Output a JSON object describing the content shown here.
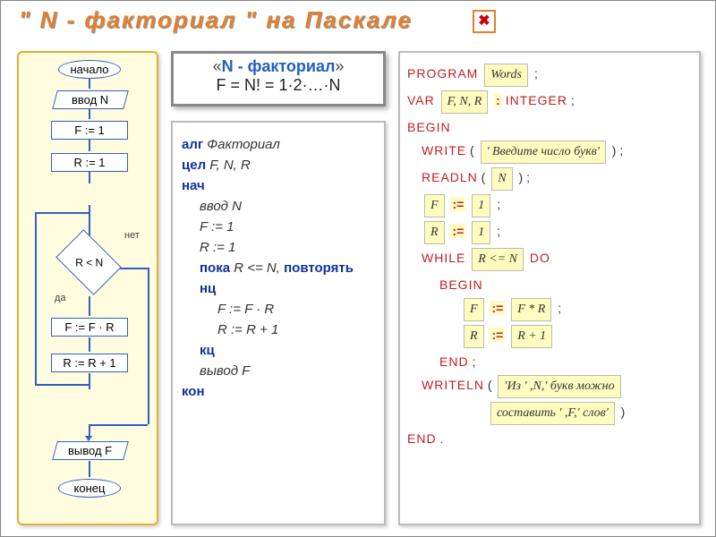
{
  "title": "\" N - факториал \"  на  Паскале",
  "close_glyph": "✖",
  "flowchart": {
    "start": "начало",
    "input": "ввод N",
    "f1": "F := 1",
    "r1": "R := 1",
    "cond": "R < N",
    "yes": "да",
    "no": "нет",
    "fupd": "F := F · R",
    "rupd": "R := R + 1",
    "output": "вывод F",
    "end": "конец"
  },
  "mid_header": {
    "line1_a": "«",
    "line1_b": "N - факториал",
    "line1_c": "»",
    "line2": "F = N! = 1·2·…·N"
  },
  "algo": {
    "alg": "алг",
    "alg_name": "Факториал",
    "decl": "цел",
    "decl_vars": "F, N, R",
    "begin": "нач",
    "input": "ввод N",
    "f1": "F := 1",
    "r1": "R := 1",
    "while_a": "пока",
    "while_cond": "R <= N,",
    "while_b": "повторять",
    "nc": "нц",
    "fupd": "F := F · R",
    "rupd": "R := R + 1",
    "kc": "кц",
    "output": "вывод F",
    "end": "кон"
  },
  "pascal": {
    "program_kw": "PROGRAM",
    "program_name": "Words",
    "var_kw": "VAR",
    "var_list": "F, N, R",
    "colon": ":",
    "integer": "INTEGER",
    "begin": "BEGIN",
    "write": "WRITE",
    "write_arg": "' Введите число букв'",
    "readln": "READLN",
    "readln_arg": "N",
    "f_var": "F",
    "assign": ":=",
    "one": "1",
    "r_var": "R",
    "while_kw": "WHILE",
    "while_cond": "R <= N",
    "do_kw": "DO",
    "begin2": "BEGIN",
    "f_expr": "F * R",
    "r_expr": "R + 1",
    "end_inner": "END",
    "writeln": "WRITELN",
    "writeln_arg1": "'Из ' ,N,' букв можно",
    "writeln_arg2": "составить ' ,F,' слов'",
    "end_outer": "END",
    "dot": "."
  }
}
